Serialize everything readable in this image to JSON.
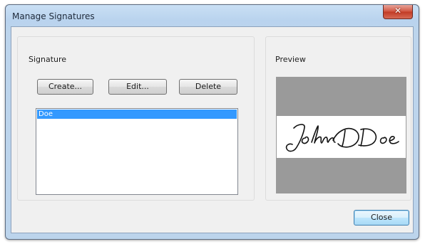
{
  "window": {
    "title": "Manage Signatures",
    "close_glyph": "✕"
  },
  "signature_group": {
    "label": "Signature",
    "buttons": {
      "create": "Create...",
      "edit": "Edit...",
      "delete": "Delete"
    },
    "list": {
      "items": [
        "Doe"
      ],
      "selected_index": 0
    }
  },
  "preview_group": {
    "label": "Preview",
    "signature_text": "John Doe"
  },
  "footer": {
    "close_label": "Close"
  },
  "colors": {
    "selection": "#3399ff",
    "preview_background": "#9a9a9a"
  }
}
